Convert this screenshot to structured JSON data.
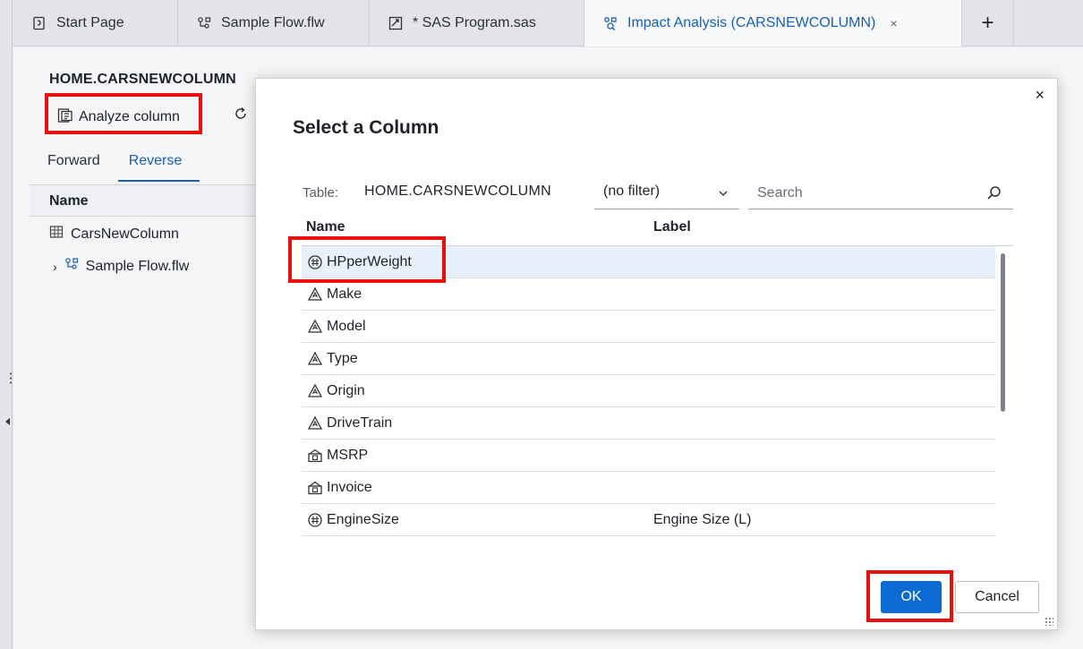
{
  "tabs": [
    {
      "label": "Start Page",
      "icon": "start-page-icon"
    },
    {
      "label": "Sample Flow.flw",
      "icon": "flow-icon"
    },
    {
      "label": "* SAS Program.sas",
      "icon": "sas-program-icon"
    },
    {
      "label": "Impact Analysis (CARSNEWCOLUMN)",
      "icon": "impact-analysis-icon",
      "active": true,
      "close": "×"
    }
  ],
  "add_tab_label": "+",
  "page": {
    "title": "HOME.CARSNEWCOLUMN",
    "analyze_label": "Analyze column",
    "direction_tabs": [
      "Forward",
      "Reverse"
    ],
    "tree_header": "Name",
    "tree_items": [
      {
        "label": "CarsNewColumn",
        "icon": "table-icon"
      },
      {
        "label": "Sample Flow.flw",
        "icon": "flow-icon"
      }
    ]
  },
  "dialog": {
    "title": "Select a Column",
    "close": "×",
    "table_label": "Table:",
    "table_name": "HOME.CARSNEWCOLUMN",
    "filter_value": "(no filter)",
    "search_placeholder": "Search",
    "columns_header": {
      "name": "Name",
      "label": "Label"
    },
    "rows": [
      {
        "name": "HPperWeight",
        "label": "",
        "type": "numeric",
        "selected": true
      },
      {
        "name": "Make",
        "label": "",
        "type": "character"
      },
      {
        "name": "Model",
        "label": "",
        "type": "character"
      },
      {
        "name": "Type",
        "label": "",
        "type": "character"
      },
      {
        "name": "Origin",
        "label": "",
        "type": "character"
      },
      {
        "name": "DriveTrain",
        "label": "",
        "type": "character"
      },
      {
        "name": "MSRP",
        "label": "",
        "type": "currency"
      },
      {
        "name": "Invoice",
        "label": "",
        "type": "currency"
      },
      {
        "name": "EngineSize",
        "label": "Engine Size (L)",
        "type": "numeric"
      }
    ],
    "ok_label": "OK",
    "cancel_label": "Cancel"
  },
  "colors": {
    "accent": "#0b6bd3",
    "highlight_box": "#e8100c",
    "selected_row": "#e8f1fb"
  }
}
